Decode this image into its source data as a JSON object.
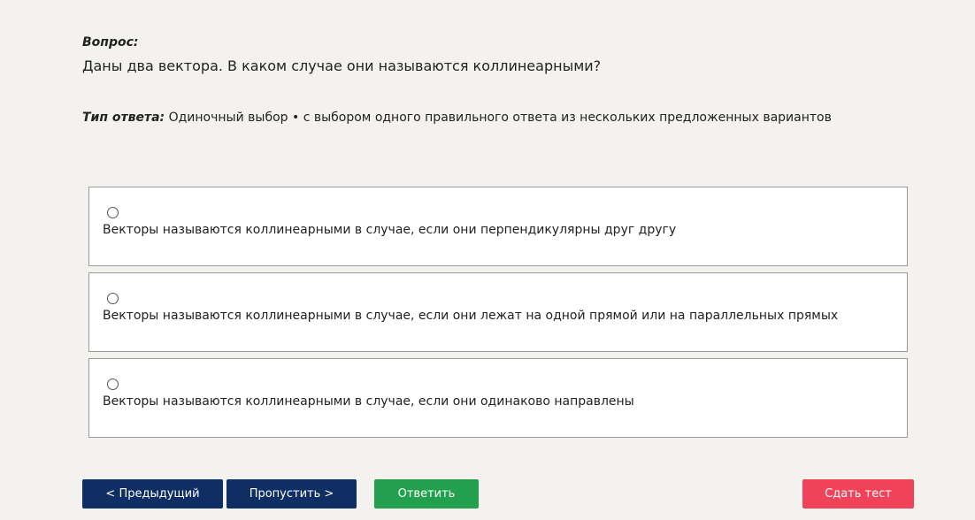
{
  "question": {
    "label": "Вопрос:",
    "text": "Даны два вектора. В каком случае они называются коллинеарными?"
  },
  "answer_type": {
    "label": "Тип ответа:",
    "value": " Одиночный выбор • с выбором одного правильного ответа из нескольких предложенных вариантов"
  },
  "options": [
    {
      "text": "Векторы называются коллинеарными в случае, если они перпендикулярны друг другу"
    },
    {
      "text": "Векторы называются коллинеарными в случае, если они лежат на одной прямой или на параллельных прямых"
    },
    {
      "text": "Векторы называются коллинеарными в случае, если они одинаково направлены"
    }
  ],
  "buttons": {
    "prev": "< Предыдущий",
    "skip": "Пропустить >",
    "answer": "Ответить",
    "submit": "Сдать тест"
  },
  "colors": {
    "background": "#f3f2ef",
    "nav_button": "#0f2e63",
    "answer_button": "#22a04e",
    "submit_button": "#f0435a"
  }
}
